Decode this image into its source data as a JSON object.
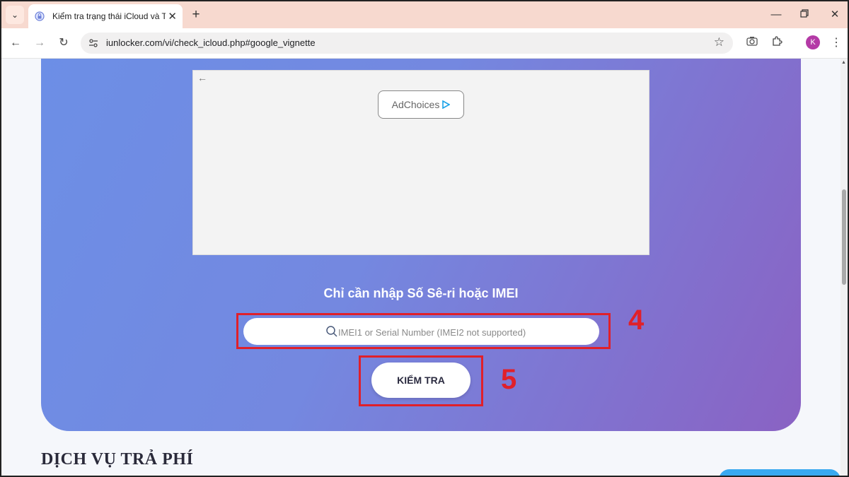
{
  "browser": {
    "tab_title": "Kiểm tra trạng thái iCloud và Tr",
    "tab_close": "✕",
    "new_tab": "+",
    "url": "iunlocker.com/vi/check_icloud.php#google_vignette",
    "profile_initial": "K"
  },
  "ad": {
    "adchoices_label": "AdChoices"
  },
  "form": {
    "prompt": "Chỉ cần nhập Số Sê-ri hoặc IMEI",
    "input_placeholder": "IMEI1 or Serial Number (IMEI2 not supported)",
    "input_value": "",
    "submit_label": "KIỂM TRA"
  },
  "annotations": {
    "step_input": "4",
    "step_button": "5",
    "highlight_color": "#e0202a"
  },
  "section": {
    "title": "DỊCH VỤ TRẢ PHÍ"
  },
  "colors": {
    "hero_start": "#6c8fe6",
    "hero_end": "#8a62c3",
    "tabstrip": "#f7d9cf"
  }
}
